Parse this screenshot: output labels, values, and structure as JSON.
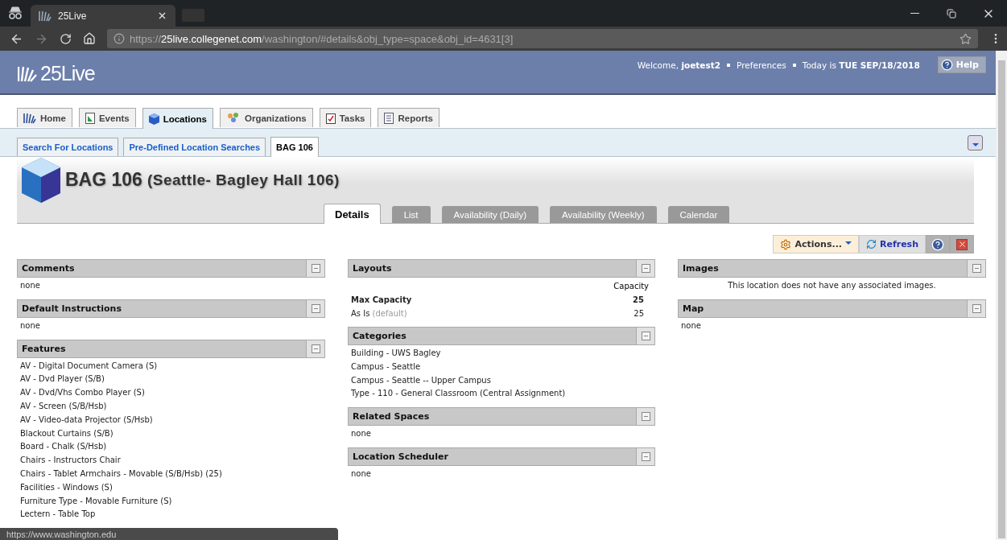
{
  "browser": {
    "tab_title": "25Live",
    "url": {
      "scheme": "https://",
      "host": "25live.collegenet.com",
      "path": "/washington/#details&obj_type=space&obj_id=4631[3]"
    }
  },
  "header": {
    "logo": "25Live",
    "welcome": "Welcome,",
    "user": "joetest2",
    "preferences": "Preferences",
    "today_label": "Today is",
    "date": "TUE SEP/18/2018",
    "help": "Help"
  },
  "main_tabs": [
    {
      "label": "Home",
      "selected": false
    },
    {
      "label": "Events",
      "selected": false
    },
    {
      "label": "Locations",
      "selected": true
    },
    {
      "label": "Organizations",
      "selected": false
    },
    {
      "label": "Tasks",
      "selected": false
    },
    {
      "label": "Reports",
      "selected": false
    }
  ],
  "sub_tabs": [
    {
      "label": "Search For Locations",
      "selected": false
    },
    {
      "label": "Pre-Defined Location Searches",
      "selected": false
    },
    {
      "label": "BAG 106",
      "selected": true
    }
  ],
  "title": {
    "code": "BAG 106",
    "name": "(Seattle- Bagley Hall 106)"
  },
  "detail_tabs": [
    {
      "label": "Details",
      "selected": true
    },
    {
      "label": "List",
      "selected": false
    },
    {
      "label": "Availability (Daily)",
      "selected": false
    },
    {
      "label": "Availability (Weekly)",
      "selected": false
    },
    {
      "label": "Calendar",
      "selected": false
    }
  ],
  "toolbar": {
    "actions": "Actions...",
    "refresh": "Refresh"
  },
  "columns": [
    [
      {
        "title": "Comments",
        "kind": "lines",
        "lines": [
          "none"
        ]
      },
      {
        "title": "Default Instructions",
        "kind": "lines",
        "lines": [
          "none"
        ]
      },
      {
        "title": "Features",
        "kind": "lines",
        "lines": [
          "AV - Digital Document Camera (S)",
          "AV - Dvd Player (S/B)",
          "AV - Dvd/Vhs Combo Player (S)",
          "AV - Screen (S/B/Hsb)",
          "AV - Video-data Projector (S/Hsb)",
          "Blackout Curtains (S/B)",
          "Board - Chalk (S/Hsb)",
          "Chairs - Instructors Chair",
          "Chairs - Tablet Armchairs - Movable (S/B/Hsb) (25)",
          "Facilities - Windows (S)",
          "Furniture Type - Movable Furniture (S)",
          "Lectern - Table Top"
        ]
      }
    ],
    [
      {
        "title": "Layouts",
        "kind": "layouts",
        "capacity_header": "Capacity",
        "rows": [
          {
            "name": "Max Capacity",
            "kind": "max",
            "capacity": "25"
          },
          {
            "name": "As Is",
            "note": "(default)",
            "kind": "plain",
            "capacity": "25"
          }
        ]
      },
      {
        "title": "Categories",
        "kind": "lines",
        "lines": [
          "Building - UWS Bagley",
          "Campus - Seattle",
          "Campus - Seattle -- Upper Campus",
          "Type - 110 - General Classroom (Central Assignment)"
        ]
      },
      {
        "title": "Related Spaces",
        "kind": "lines",
        "lines": [
          "none"
        ]
      },
      {
        "title": "Location Scheduler",
        "kind": "lines",
        "lines": [
          "none"
        ]
      }
    ],
    [
      {
        "title": "Images",
        "kind": "message",
        "lines": [
          "This location does not have any associated images."
        ]
      },
      {
        "title": "Map",
        "kind": "lines",
        "lines": [
          "none"
        ]
      }
    ]
  ],
  "status_bar": "https://www.washington.edu"
}
